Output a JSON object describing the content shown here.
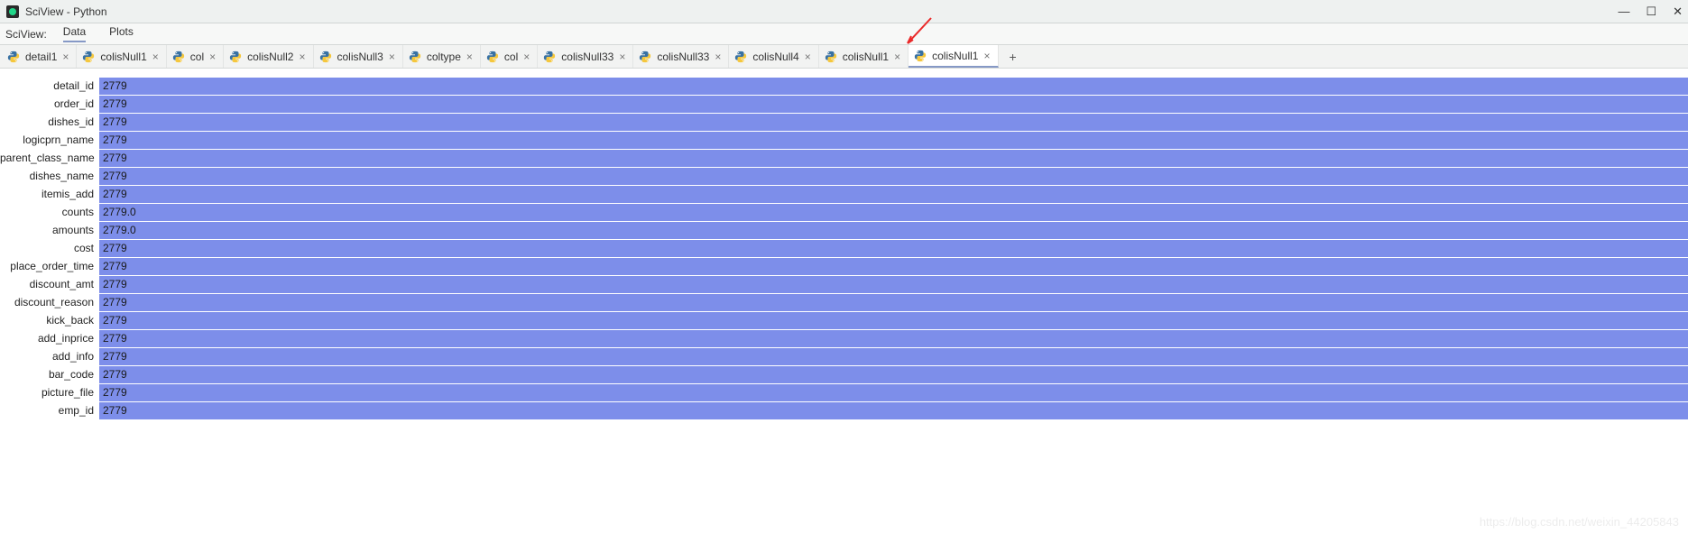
{
  "window": {
    "title": "SciView - Python"
  },
  "menubar": {
    "panel_label": "SciView:",
    "items": [
      {
        "label": "Data",
        "active": true
      },
      {
        "label": "Plots",
        "active": false
      }
    ]
  },
  "tabs": [
    {
      "label": "detail1",
      "active": false
    },
    {
      "label": "colisNull1",
      "active": false
    },
    {
      "label": "col",
      "active": false
    },
    {
      "label": "colisNull2",
      "active": false
    },
    {
      "label": "colisNull3",
      "active": false
    },
    {
      "label": "coltype",
      "active": false
    },
    {
      "label": "col",
      "active": false
    },
    {
      "label": "colisNull33",
      "active": false
    },
    {
      "label": "colisNull33",
      "active": false
    },
    {
      "label": "colisNull4",
      "active": false
    },
    {
      "label": "colisNull1",
      "active": false
    },
    {
      "label": "colisNull1",
      "active": true
    }
  ],
  "rows": [
    {
      "name": "detail_id",
      "value": "2779"
    },
    {
      "name": "order_id",
      "value": "2779"
    },
    {
      "name": "dishes_id",
      "value": "2779"
    },
    {
      "name": "logicprn_name",
      "value": "2779"
    },
    {
      "name": "parent_class_name",
      "value": "2779"
    },
    {
      "name": "dishes_name",
      "value": "2779"
    },
    {
      "name": "itemis_add",
      "value": "2779"
    },
    {
      "name": "counts",
      "value": "2779.0"
    },
    {
      "name": "amounts",
      "value": "2779.0"
    },
    {
      "name": "cost",
      "value": "2779"
    },
    {
      "name": "place_order_time",
      "value": "2779"
    },
    {
      "name": "discount_amt",
      "value": "2779"
    },
    {
      "name": "discount_reason",
      "value": "2779"
    },
    {
      "name": "kick_back",
      "value": "2779"
    },
    {
      "name": "add_inprice",
      "value": "2779"
    },
    {
      "name": "add_info",
      "value": "2779"
    },
    {
      "name": "bar_code",
      "value": "2779"
    },
    {
      "name": "picture_file",
      "value": "2779"
    },
    {
      "name": "emp_id",
      "value": "2779"
    }
  ],
  "watermark": "https://blog.csdn.net/weixin_44205843"
}
